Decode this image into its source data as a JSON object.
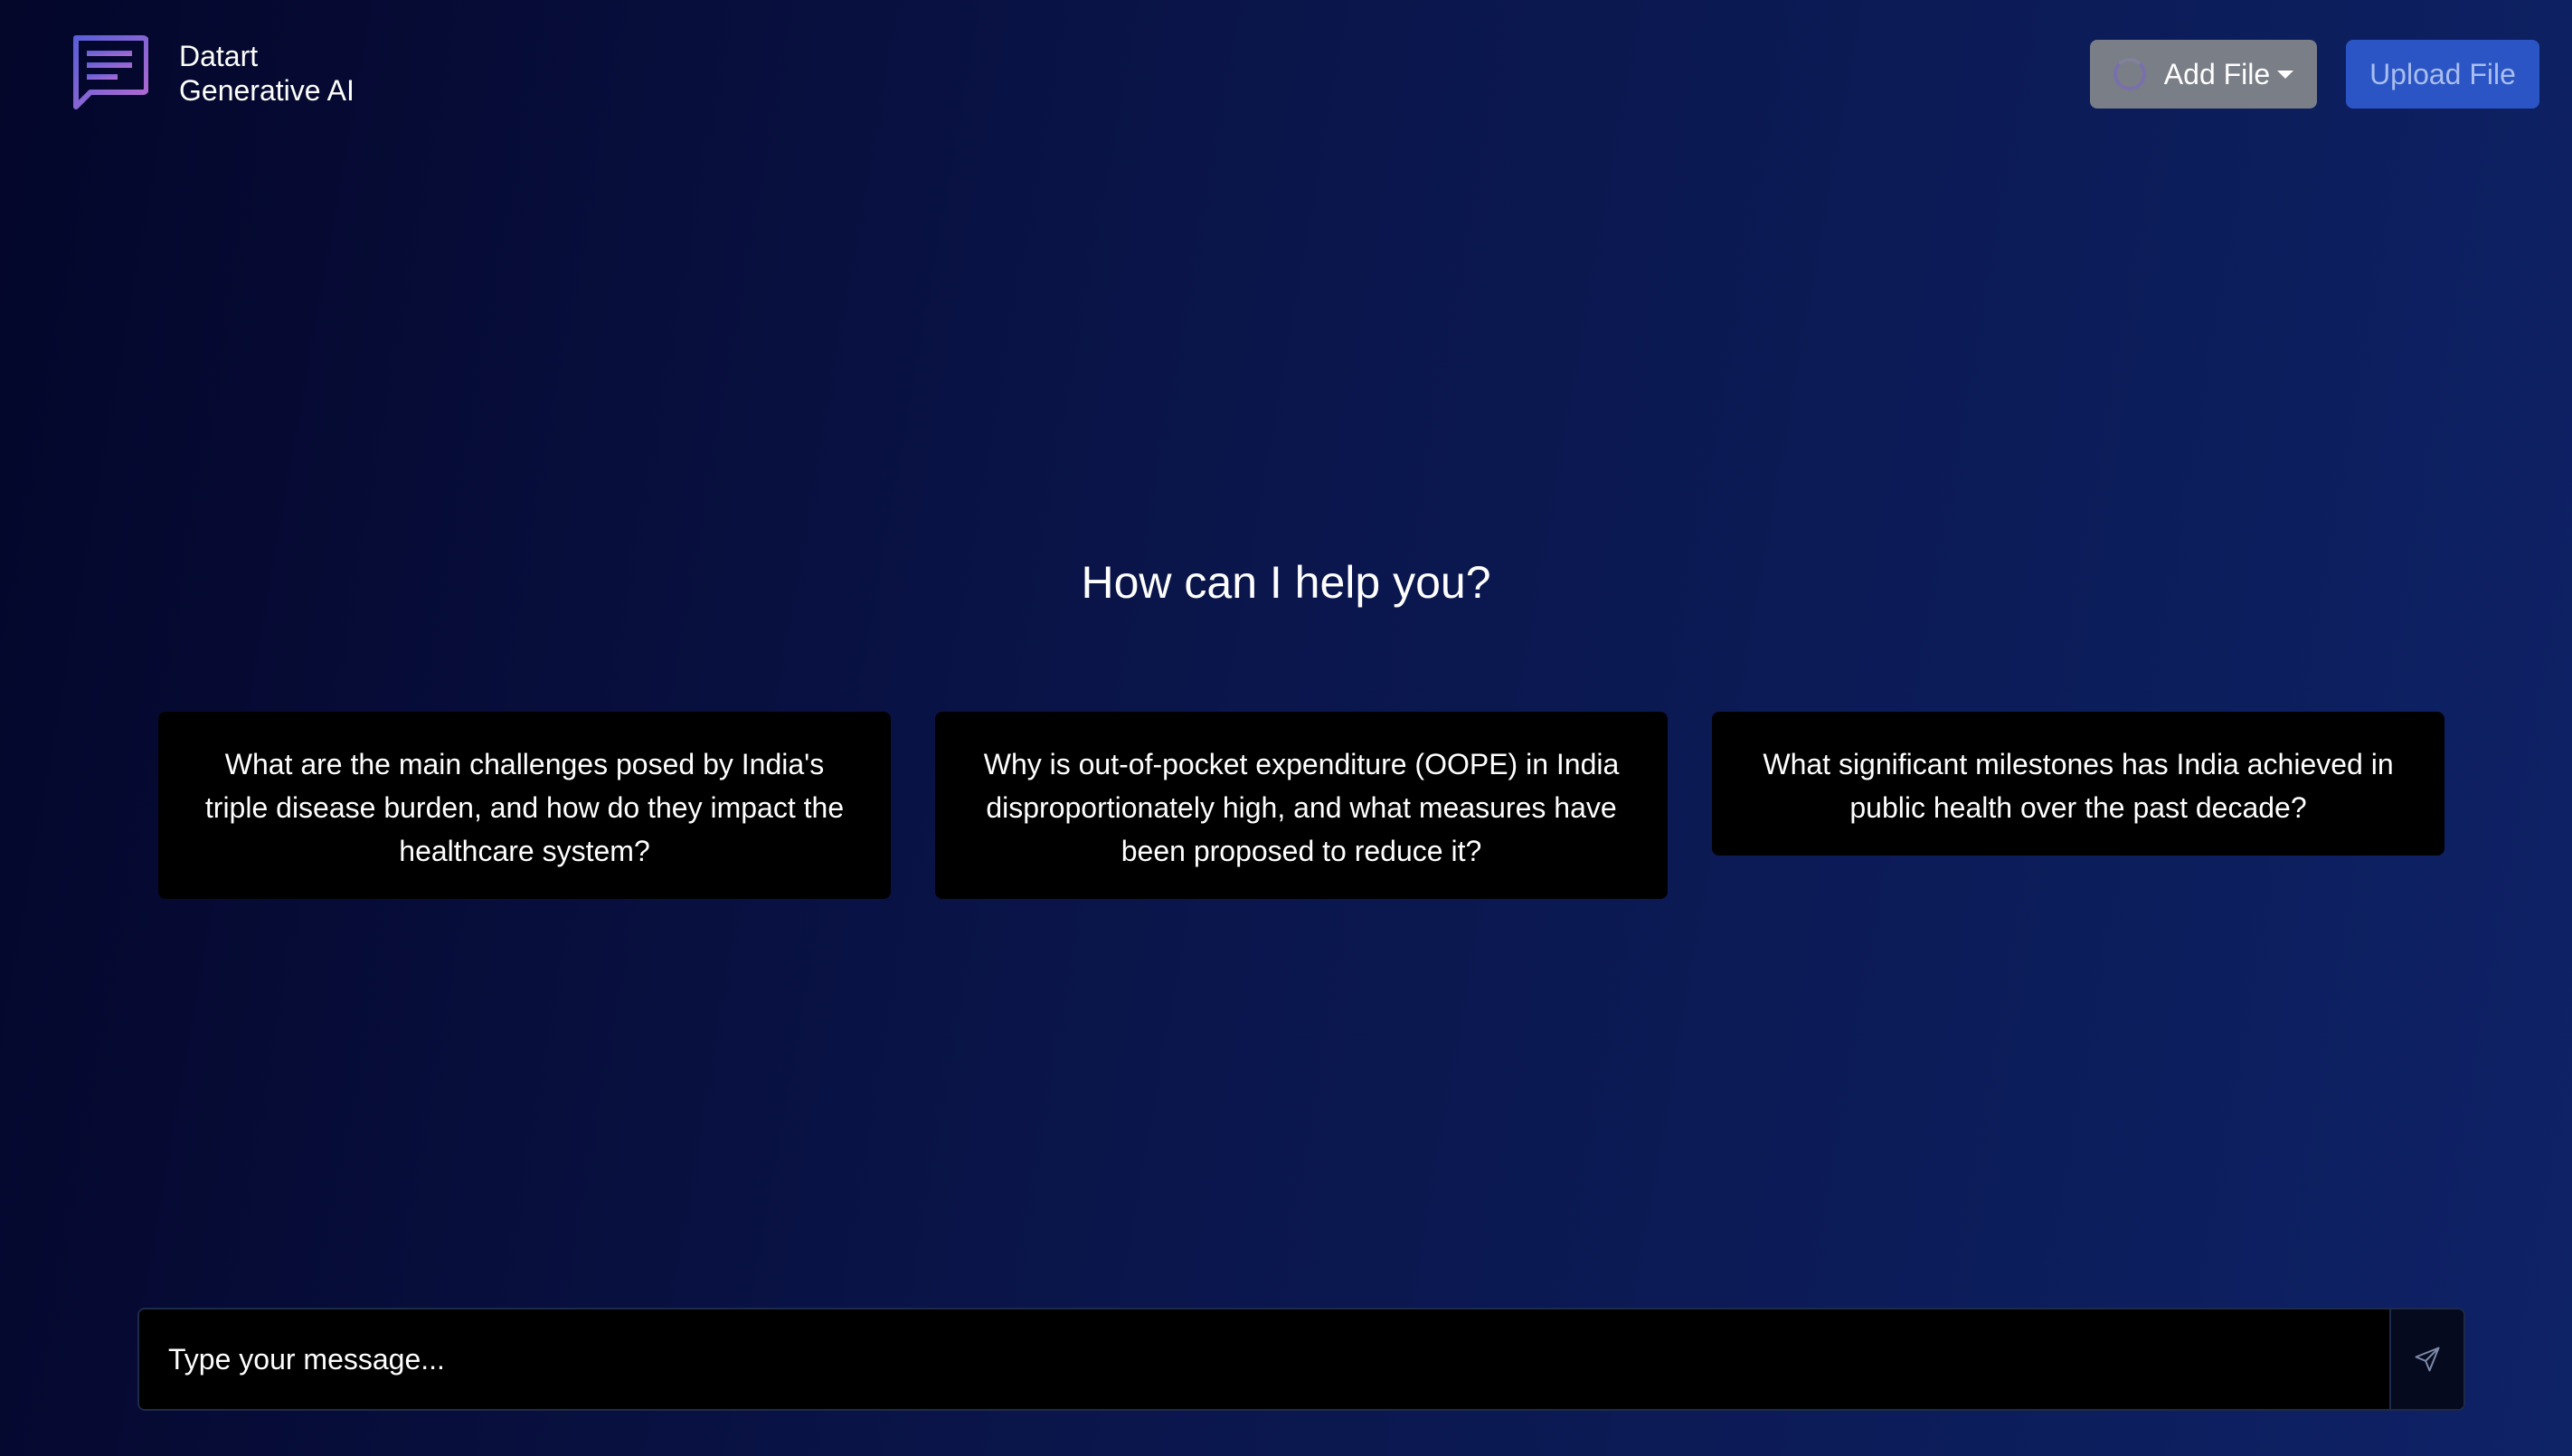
{
  "brand": {
    "name": "Datart",
    "subtitle": "Generative AI",
    "logo_icon": "chat-bubble-icon"
  },
  "header": {
    "add_file_label": "Add File",
    "upload_file_label": "Upload File"
  },
  "main": {
    "heading": "How can I help you?",
    "suggestions": [
      "What are the main challenges posed by India's triple disease burden, and how do they impact the healthcare system?",
      "Why is out-of-pocket expenditure (OOPE) in India disproportionately high, and what measures have been proposed to reduce it?",
      "What significant milestones has India achieved in public health over the past decade?"
    ]
  },
  "composer": {
    "placeholder": "Type your message...",
    "value": "",
    "send_icon": "send-icon"
  },
  "colors": {
    "background_start": "#04062a",
    "background_end": "#0e2266",
    "add_file_button": "#7a7e87",
    "upload_file_button": "#2b55c4",
    "card_background": "#000000",
    "logo_gradient_start": "#5a5fd8",
    "logo_gradient_end": "#b36ad0"
  }
}
